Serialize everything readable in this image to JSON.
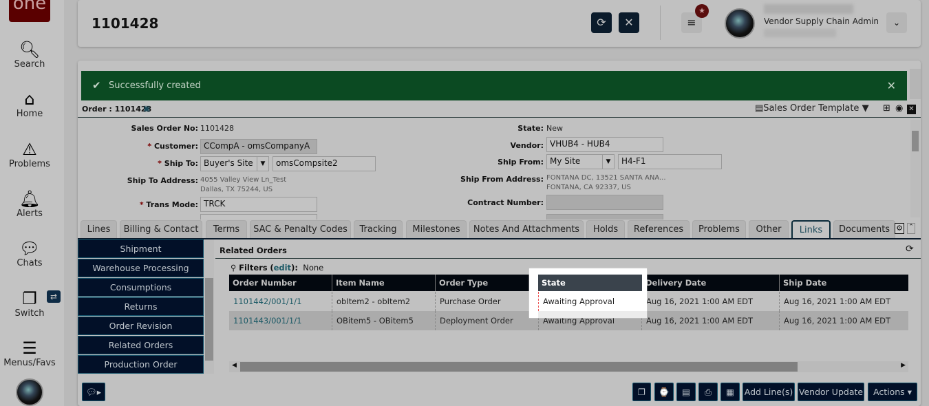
{
  "nav": {
    "logo": "one",
    "items": [
      {
        "label": "Search",
        "icon": "search-icon"
      },
      {
        "label": "Home",
        "icon": "home-icon"
      },
      {
        "label": "Problems",
        "icon": "warning-icon"
      },
      {
        "label": "Alerts",
        "icon": "bell-icon"
      },
      {
        "label": "Chats",
        "icon": "chat-icon"
      },
      {
        "label": "Switch",
        "icon": "switch-icon"
      },
      {
        "label": "Menus/Favs",
        "icon": "menu-icon"
      }
    ]
  },
  "header": {
    "title": "1101428",
    "user_role": "Vendor Supply Chain Admin"
  },
  "alert": {
    "message": "Successfully created"
  },
  "order": {
    "heading": "Order : 1101428",
    "template": "Sales Order Template",
    "fields": {
      "sales_order_no_label": "Sales Order No:",
      "sales_order_no": "1101428",
      "customer_label": "Customer:",
      "customer": "CCompA - omsCompanyA",
      "ship_to_label": "Ship To:",
      "ship_to_type": "Buyer's Site",
      "ship_to_site": "omsCompsite2",
      "ship_to_address_label": "Ship To Address:",
      "ship_to_address_1": "4055 Valley View Ln_Test",
      "ship_to_address_2": "Dallas, TX 75244, US",
      "trans_mode_label": "Trans Mode:",
      "trans_mode": "TRCK",
      "state_label": "State:",
      "state": "New",
      "vendor_label": "Vendor:",
      "vendor": "VHUB4 - HUB4",
      "ship_from_label": "Ship From:",
      "ship_from_type": "My Site",
      "ship_from_site": "H4-F1",
      "ship_from_address_label": "Ship From Address:",
      "ship_from_address_1": "FONTANA DC, 13521 SANTA ANA...",
      "ship_from_address_2": "FONTANA, CA 92337, US",
      "contract_number_label": "Contract Number:"
    }
  },
  "tabs": [
    "Lines",
    "Billing & Contact",
    "Terms",
    "SAC & Penalty Codes",
    "Tracking",
    "Milestones",
    "Notes And Attachments",
    "Holds",
    "References",
    "Problems",
    "Other",
    "Links",
    "Documents"
  ],
  "side_menu": [
    "Shipment",
    "Warehouse Processing",
    "Consumptions",
    "Returns",
    "Order Revision",
    "Related Orders",
    "Production Order"
  ],
  "related": {
    "title": "Related Orders",
    "filters_label": "Filters",
    "filters_edit": "edit",
    "filters_value": "None",
    "columns": [
      "Order Number",
      "Item Name",
      "Order Type",
      "State",
      "Delivery Date",
      "Ship Date"
    ],
    "rows": [
      [
        "1101442/001/1/1",
        "obItem2 - obItem2",
        "Purchase Order",
        "Awaiting Approval",
        "Aug 16, 2021 1:00 AM EDT",
        "Aug 16, 2021 1:00 AM EDT"
      ],
      [
        "1101443/001/1/1",
        "OBitem5 - OBitem5",
        "Deployment Order",
        "Awaiting Approval",
        "Aug 16, 2021 1:00 AM EDT",
        "Aug 16, 2021 1:00 AM EDT"
      ]
    ]
  },
  "footer": {
    "add_lines": "Add Line(s)",
    "vendor_update": "Vendor Update",
    "actions": "Actions"
  }
}
